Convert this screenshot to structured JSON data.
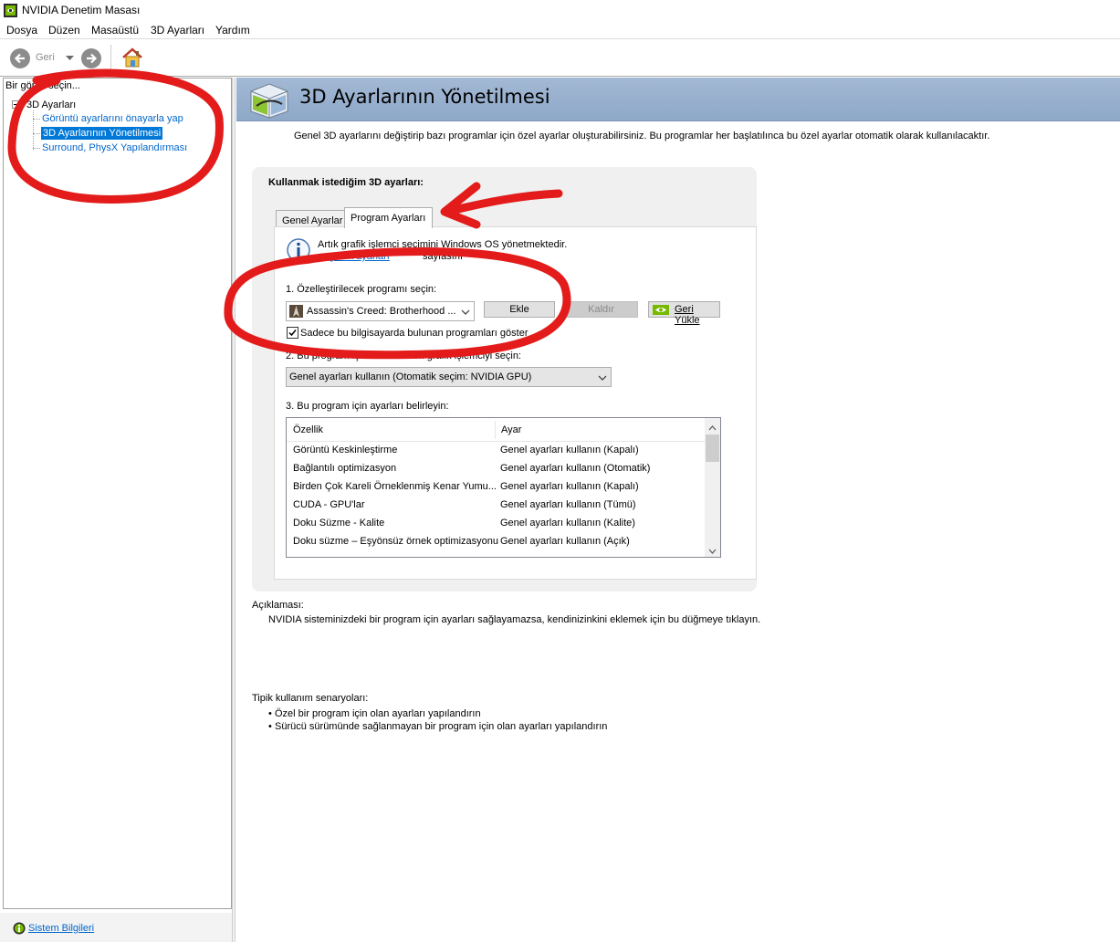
{
  "window": {
    "title": "NVIDIA Denetim Masası"
  },
  "menu": [
    "Dosya",
    "Düzen",
    "Masaüstü",
    "3D Ayarları",
    "Yardım"
  ],
  "toolbar": {
    "back_label": "Geri"
  },
  "left_panel": {
    "header": "Bir görev seçin...",
    "tree_root": "3D Ayarları",
    "tree_items": [
      "Görüntü ayarlarını önayarla yap",
      "3D Ayarlarının Yönetilmesi",
      "Surround, PhysX Yapılandırması"
    ],
    "selected_index": 1
  },
  "status": {
    "system_info_label": "Sistem Bilgileri"
  },
  "page": {
    "title": "3D Ayarlarının Yönetilmesi",
    "description": "Genel 3D ayarlarını değiştirip bazı programlar için özel ayarlar oluşturabilirsiniz. Bu programlar her başlatılınca bu özel ayarlar otomatik olarak kullanılacaktır.",
    "group_title": "Kullanmak istediğim 3D ayarları:",
    "tabs": [
      "Genel Ayarlar",
      "Program Ayarları"
    ],
    "active_tab": 1,
    "info_text": "Artık grafik işlemci seçimini Windows OS yönetmektedir.",
    "info_link_fragment": "... grafik ayarları",
    "info_text_suffix": "sayfasını",
    "step1_label": "1. Özelleştirilecek programı seçin:",
    "program_selected": "Assassin's Creed: Brotherhood ...",
    "add_button": "Ekle",
    "remove_button": "Kaldır",
    "restore_button": "Geri Yükle",
    "only_local_checkbox": "Sadece bu bilgisayarda bulunan programları göster",
    "only_local_checked": true,
    "step2_label": "2. Bu program için tercih edilen grafik işlemciyi seçin:",
    "gpu_selected": "Genel ayarları kullanın (Otomatik seçim: NVIDIA GPU)",
    "step3_label": "3. Bu program için ayarları belirleyin:",
    "table_headers": [
      "Özellik",
      "Ayar"
    ],
    "table_rows": [
      [
        "Görüntü Keskinleştirme",
        "Genel ayarları kullanın (Kapalı)"
      ],
      [
        "Bağlantılı optimizasyon",
        "Genel ayarları kullanın (Otomatik)"
      ],
      [
        "Birden Çok Kareli Örneklenmiş Kenar Yumu...",
        "Genel ayarları kullanın (Kapalı)"
      ],
      [
        "CUDA - GPU'lar",
        "Genel ayarları kullanın (Tümü)"
      ],
      [
        "Doku Süzme - Kalite",
        "Genel ayarları kullanın (Kalite)"
      ],
      [
        "Doku süzme – Eşyönsüz örnek optimizasyonu",
        "Genel ayarları kullanın (Açık)"
      ]
    ],
    "description_label": "Açıklaması:",
    "description_text": "NVIDIA sisteminizdeki bir program için ayarları sağlayamazsa, kendinizinkini eklemek için bu düğmeye tıklayın.",
    "usage_label": "Tipik kullanım senaryoları:",
    "usage_items": [
      "Özel bir program için olan ayarları yapılandırın",
      "Sürücü sürümünde sağlanmayan bir program için olan ayarları yapılandırın"
    ]
  },
  "colors": {
    "annotation_red": "#e31b1b",
    "nvidia_green": "#76b900",
    "selection_blue": "#0078d7",
    "link_blue": "#0066cc",
    "header_band": "#a3b9d5"
  }
}
